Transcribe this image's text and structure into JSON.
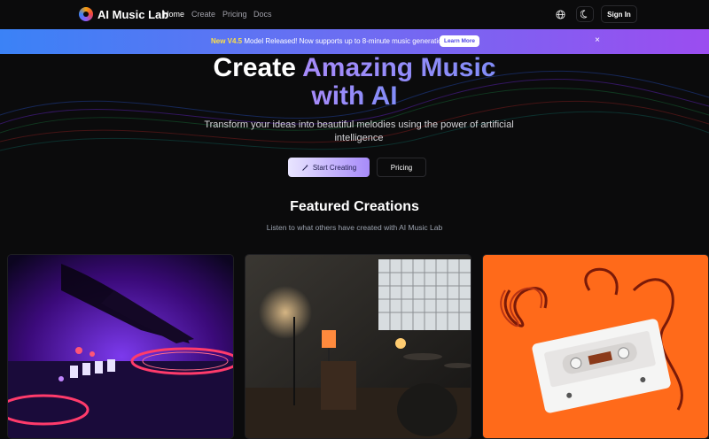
{
  "nav": {
    "brand": "AI Music Lab",
    "links": [
      "Home",
      "Create",
      "Pricing",
      "Docs"
    ],
    "sign_in": "Sign In"
  },
  "banner": {
    "new_label": "New V4.5",
    "message": " Model Released! Now supports up to 8-minute music generation",
    "cta": "Learn More",
    "close": "×"
  },
  "hero": {
    "title_line1_plain": "Create ",
    "title_line1_grad": "Amazing Music",
    "title_line2": "with AI",
    "subtitle": "Transform your ideas into beautiful melodies using the power of artificial intelligence",
    "primary_cta": "Start Creating",
    "secondary_cta": "Pricing"
  },
  "featured": {
    "title": "Featured Creations",
    "subtitle": "Listen to what others have created with AI Music Lab"
  },
  "colors": {
    "accent": "#a78bfa",
    "banner_start": "#3b82f6",
    "banner_end": "#9b4df0",
    "card3_bg": "#ff6a1a"
  }
}
